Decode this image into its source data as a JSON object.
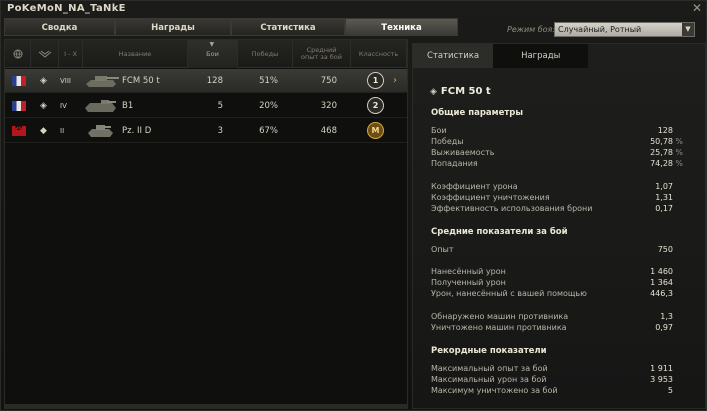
{
  "window": {
    "title": "PoKeMoN_NA_TaNkE",
    "close_glyph": "✕"
  },
  "tabs": [
    {
      "label": "Сводка",
      "active": false
    },
    {
      "label": "Награды",
      "active": false
    },
    {
      "label": "Статистика",
      "active": false
    },
    {
      "label": "Техника",
      "active": true
    }
  ],
  "battle_mode": {
    "label": "Режим боя:",
    "value": "Случайный, Ротный"
  },
  "table": {
    "headers": {
      "nation_icon": "globe-icon",
      "type_icon": "tank-class-icon",
      "tier": "I - X",
      "name": "Название",
      "battles": "Бои",
      "wins": "Победы",
      "avg_exp": "Средний опыт за бой",
      "mastery": "Классность"
    },
    "rows": [
      {
        "nation": "France",
        "tier": "VIII",
        "name": "FCM 50 t",
        "battles": "128",
        "wins": "51%",
        "avg_exp": "750",
        "mastery": "1",
        "selected": true
      },
      {
        "nation": "France",
        "tier": "IV",
        "name": "B1",
        "battles": "5",
        "wins": "20%",
        "avg_exp": "320",
        "mastery": "2",
        "selected": false
      },
      {
        "nation": "Germany",
        "tier": "II",
        "name": "Pz. II D",
        "battles": "3",
        "wins": "67%",
        "avg_exp": "468",
        "mastery": "M",
        "selected": false
      }
    ]
  },
  "details": {
    "tabs": [
      {
        "label": "Статистика",
        "active": true
      },
      {
        "label": "Награды",
        "active": false
      }
    ],
    "vehicle": "FCM 50 t",
    "sections": {
      "general": {
        "title": "Общие параметры",
        "stats": [
          {
            "label": "Бои",
            "value": "128",
            "pct": ""
          },
          {
            "label": "Победы",
            "value": "50,78",
            "pct": "%"
          },
          {
            "label": "Выживаемость",
            "value": "25,78",
            "pct": "%"
          },
          {
            "label": "Попадания",
            "value": "74,28",
            "pct": "%"
          },
          {
            "label": "Коэффициент урона",
            "value": "1,07",
            "pct": ""
          },
          {
            "label": "Коэффициент уничтожения",
            "value": "1,31",
            "pct": ""
          },
          {
            "label": "Эффективность использования брони",
            "value": "0,17",
            "pct": ""
          }
        ]
      },
      "average": {
        "title": "Средние показатели за бой",
        "stats": [
          {
            "label": "Опыт",
            "value": "750"
          },
          {
            "label": "Нанесённый урон",
            "value": "1 460"
          },
          {
            "label": "Полученный урон",
            "value": "1 364"
          },
          {
            "label": "Урон, нанесённый с вашей помощью",
            "value": "446,3"
          },
          {
            "label": "Обнаружено машин противника",
            "value": "1,3"
          },
          {
            "label": "Уничтожено машин противника",
            "value": "0,97"
          }
        ]
      },
      "records": {
        "title": "Рекордные показатели",
        "stats": [
          {
            "label": "Максимальный опыт за бой",
            "value": "1 911"
          },
          {
            "label": "Максимальный урон за бой",
            "value": "3 953"
          },
          {
            "label": "Максимум уничтожено за бой",
            "value": "5"
          }
        ]
      }
    }
  },
  "colors": {
    "accent": "#e0a040",
    "text": "#d6d3c4",
    "background": "#0f0f0e"
  }
}
